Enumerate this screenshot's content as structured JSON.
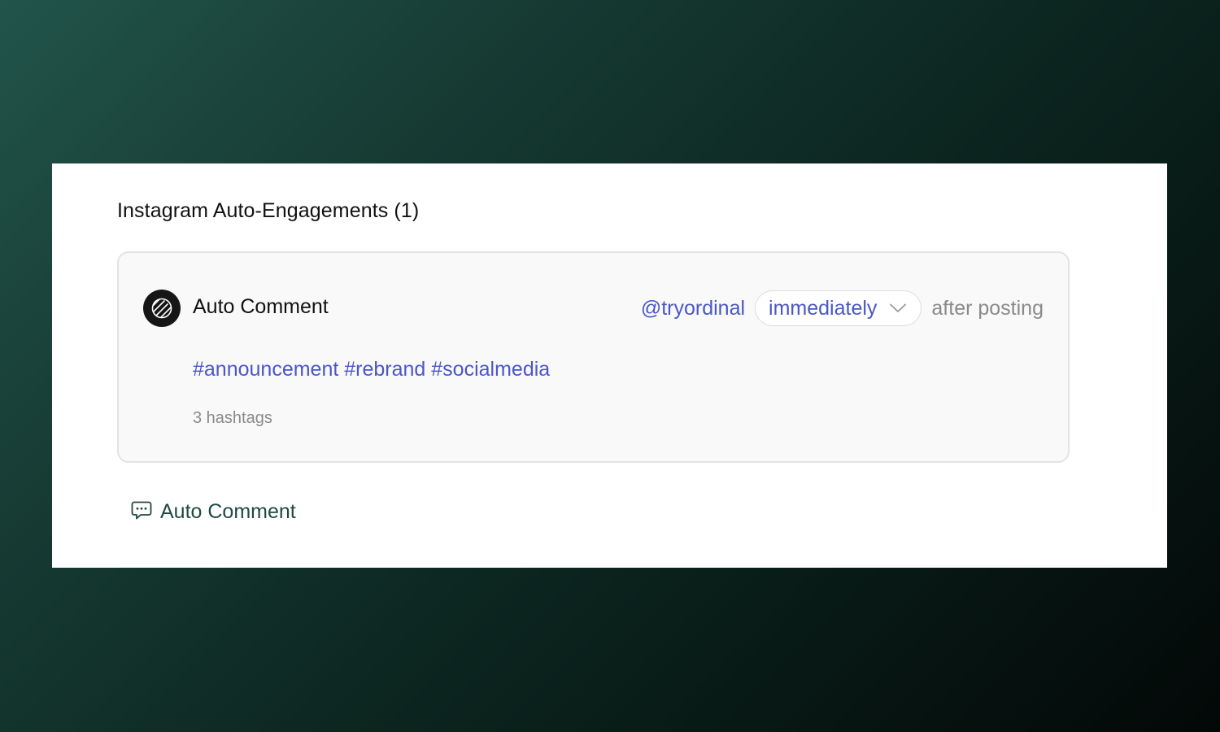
{
  "section": {
    "title": "Instagram Auto-Engagements (1)"
  },
  "engagement": {
    "type_label": "Auto Comment",
    "avatar_icon": "ordinal-logo-icon",
    "handle": "@tryordinal",
    "timing": {
      "selected": "immediately",
      "icon": "chevron-down-icon"
    },
    "after_text": "after posting",
    "comment_text": "#announcement #rebrand #socialmedia",
    "hashtag_count": "3 hashtags"
  },
  "add_action": {
    "icon": "comment-bubble-icon",
    "label": "Auto Comment"
  },
  "colors": {
    "accent_blue": "#4a57c7",
    "muted_gray": "#8a8a8a",
    "action_green": "#1f4a40",
    "card_bg": "#f9f9f9"
  }
}
